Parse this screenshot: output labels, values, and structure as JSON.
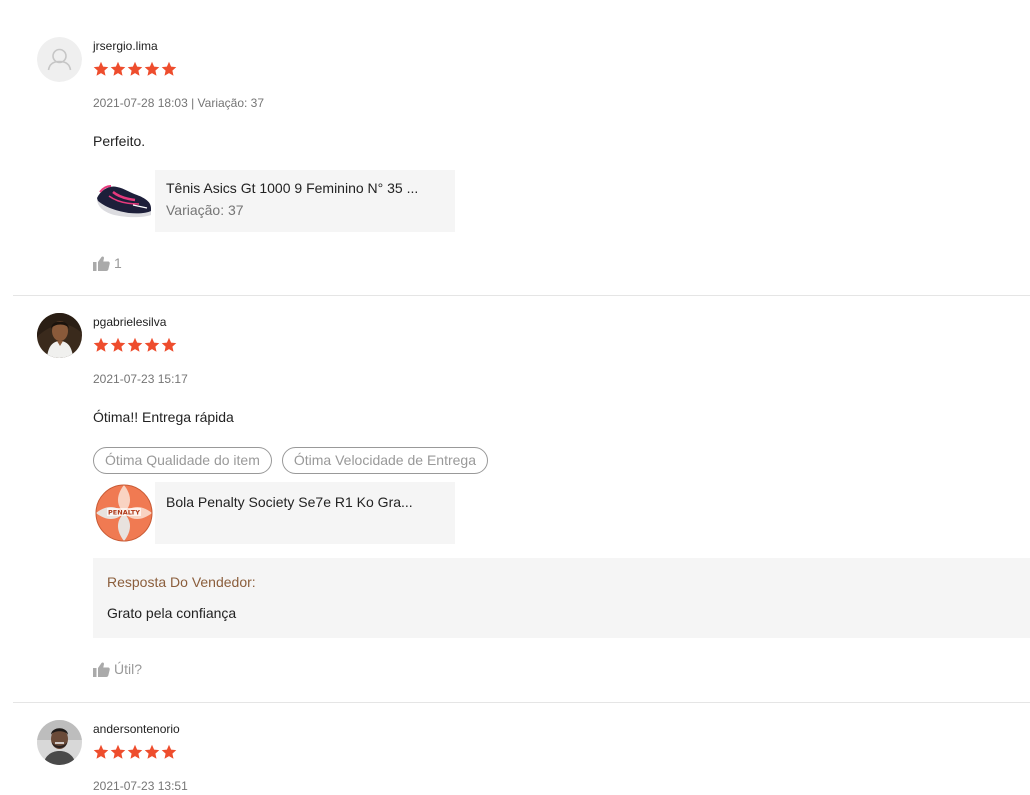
{
  "colors": {
    "star": "#ee4d2d",
    "meta_text": "#757575",
    "tag_border": "#999999",
    "seller_title": "#8b5e3c",
    "panel_bg": "#f5f5f5",
    "divider": "#e5e5e5"
  },
  "reviews": [
    {
      "username": "jrsergio.lima",
      "avatar": "default-user-icon",
      "rating": 5,
      "meta": "2021-07-28 18:03 | Variação: 37",
      "comment": "Perfeito.",
      "tags": [],
      "product": {
        "name": "Tênis Asics Gt 1000 9 Feminino N° 35 ...",
        "variation": "Variação: 37",
        "thumb": "sneaker-image"
      },
      "seller_reply": null,
      "like_label": "1"
    },
    {
      "username": "pgabrielesilva",
      "avatar": "user-photo",
      "rating": 5,
      "meta": "2021-07-23 15:17",
      "comment": "Ótima!! Entrega rápida",
      "tags": [
        "Ótima Qualidade do item",
        "Ótima Velocidade de Entrega"
      ],
      "product": {
        "name": "Bola Penalty Society Se7e R1 Ko Gra...",
        "variation": "",
        "thumb": "ball-image"
      },
      "seller_reply": {
        "title": "Resposta Do Vendedor:",
        "text": "Grato pela confiança"
      },
      "like_label": "Útil?"
    },
    {
      "username": "andersontenorio",
      "avatar": "user-photo",
      "rating": 5,
      "meta": "2021-07-23 13:51"
    }
  ]
}
